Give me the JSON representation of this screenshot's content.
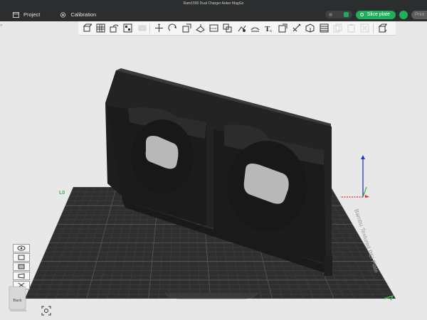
{
  "window": {
    "title": "Ram1500 Dual Charger Anker MagGo"
  },
  "menu": {
    "tabs": [
      {
        "label": "Project",
        "icon": "project-icon"
      },
      {
        "label": "Calibration",
        "icon": "calibration-icon"
      }
    ],
    "slice_label": "Slice plate",
    "print_label": "Print"
  },
  "toolbar": {
    "tools": [
      "add-object-icon",
      "add-plate-icon",
      "auto-orient-icon",
      "arrange-icon",
      "split-icon",
      "move-icon",
      "rotate-icon",
      "scale-icon",
      "lay-on-face-icon",
      "cut-icon",
      "mesh-boolean-icon",
      "support-paint-icon",
      "seam-paint-icon",
      "text-icon",
      "color-paint-icon",
      "measure-icon",
      "assembly-icon",
      "variable-layer-icon",
      "copy-icon",
      "paste-icon",
      "delete-icon",
      "view-icon"
    ]
  },
  "viewport": {
    "bed_label": "Bambu Textured PEI Plate",
    "corner_mark": "L0",
    "navcube_label": "Back",
    "colors": {
      "bed": "#2f2f2f",
      "grid": "#4a4a4a",
      "model": "#1f1f1f",
      "axis_x": "#e03030",
      "axis_y": "#3cb44b",
      "axis_z": "#2a36b8",
      "accent": "#1fae5a"
    }
  }
}
